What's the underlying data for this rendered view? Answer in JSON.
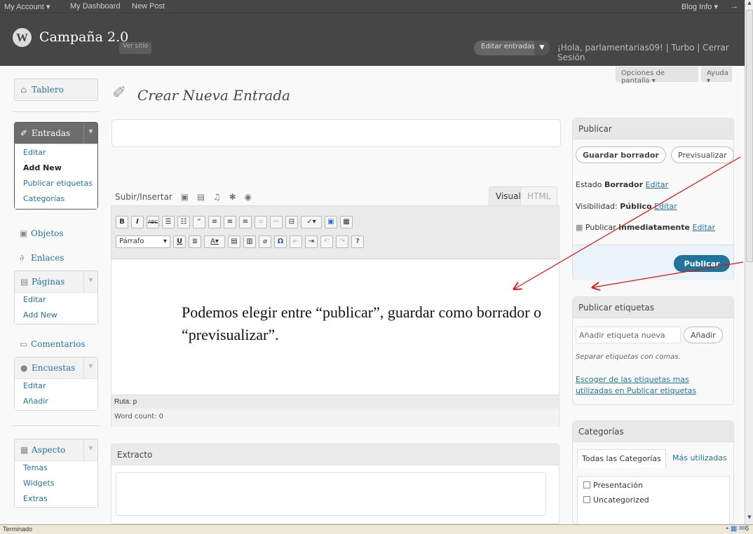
{
  "topbar": {
    "my_account": "My Account ▾",
    "my_dashboard": "My Dashboard",
    "new_post": "New Post",
    "blog_info": "Blog Info ▾",
    "logout_arrow": "→"
  },
  "header": {
    "site_name": "Campaña 2.0",
    "view_site": "Ver sitio",
    "edit_posts": "Editar entradas",
    "greeting": "¡Hola, parlamentarias09! | Turbo | Cerrar Sesión"
  },
  "screen_options": "Opciones de pantalla ▾",
  "help": "Ayuda ▾",
  "menu": {
    "dashboard": "Tablero",
    "posts": {
      "label": "Entradas",
      "items": [
        "Editar",
        "Add New",
        "Publicar etiquetas",
        "Categorías"
      ]
    },
    "media": "Objetos",
    "links": "Enlaces",
    "pages": {
      "label": "Páginas",
      "items": [
        "Editar",
        "Add New"
      ]
    },
    "comments": "Comentarios",
    "polls": {
      "label": "Encuestas",
      "items": [
        "Editar",
        "Añadir"
      ]
    },
    "appearance": {
      "label": "Aspecto",
      "items": [
        "Temas",
        "Widgets",
        "Extras"
      ]
    }
  },
  "page_title": "Crear Nueva Entrada",
  "editor": {
    "upload_insert": "Subir/Insertar",
    "tab_visual": "Visual",
    "tab_html": "HTML",
    "format": "Párrafo",
    "path": "Ruta: p",
    "word_count": "Word count: 0",
    "caption": "Podemos elegir entre “publicar”, guardar como borrador o “previsualizar”."
  },
  "excerpt": {
    "title": "Extracto"
  },
  "publish": {
    "title": "Publicar",
    "save_draft": "Guardar borrador",
    "preview": "Previsualizar",
    "status_label": "Estado",
    "status_value": "Borrador",
    "edit": "Editar",
    "visibility_label": "Visibilidad:",
    "visibility_value": "Público",
    "publish_label": "Publicar",
    "publish_value": "inmediatamente",
    "publish_button": "Publicar"
  },
  "tags": {
    "title": "Publicar etiquetas",
    "placeholder": "Añadir etiqueta nueva",
    "add": "Añadir",
    "hint": "Separar etiquetas con comas.",
    "choose": "Escoger de las etiquetas mas utilizadas en Publicar etiquetas"
  },
  "categories": {
    "title": "Categorías",
    "tab_all": "Todas las Categorías",
    "tab_popular": "Más utilizadas",
    "items": [
      "Presentación",
      "Uncategorized"
    ]
  },
  "status_bar": {
    "text": "Terminado",
    "mail_count": "6"
  }
}
